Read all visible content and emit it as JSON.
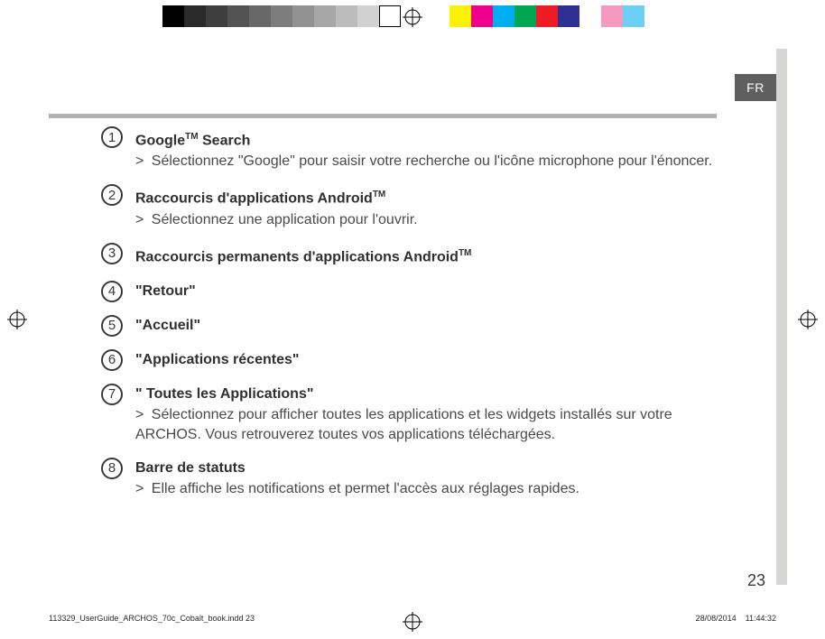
{
  "lang_tab": "FR",
  "page_number": "23",
  "footer": {
    "slug": "113329_UserGuide_ARCHOS_70c_Cobalt_book.indd   23",
    "date": "28/08/2014",
    "time": "11:44:32"
  },
  "colorbar_left": [
    "#000000",
    "#2a2a2a",
    "#3e3e3e",
    "#535353",
    "#686868",
    "#7d7d7d",
    "#929292",
    "#a7a7a7",
    "#bcbcbc",
    "#d1d1d1",
    "#ffffff"
  ],
  "colorbar_right": [
    "#fff200",
    "#ec008c",
    "#00aeef",
    "#00a651",
    "#ed1c24",
    "#2e3192",
    "#ffffff",
    "#f49ac1",
    "#6dcff6",
    "#ffffff"
  ],
  "items": [
    {
      "num": "1",
      "title_pre": "Google",
      "title_tm": "TM",
      "title_post": " Search",
      "desc": "Sélectionnez \"Google\" pour saisir votre recherche ou l'icône microphone pour l'énoncer."
    },
    {
      "num": "2",
      "title_pre": "Raccourcis d'applications Android",
      "title_tm": "TM",
      "title_post": "",
      "desc": "Sélectionnez une application pour l'ouvrir."
    },
    {
      "num": "3",
      "title_pre": "Raccourcis permanents d'applications Android",
      "title_tm": "TM",
      "title_post": "",
      "desc": ""
    },
    {
      "num": "4",
      "title_pre": "\"Retour\"",
      "title_tm": "",
      "title_post": "",
      "desc": ""
    },
    {
      "num": "5",
      "title_pre": "\"Accueil\"",
      "title_tm": "",
      "title_post": "",
      "desc": ""
    },
    {
      "num": "6",
      "title_pre": "\"Applications récentes\"",
      "title_tm": "",
      "title_post": "",
      "desc": ""
    },
    {
      "num": "7",
      "title_pre": "\" Toutes les Applications\"",
      "title_tm": "",
      "title_post": "",
      "desc": "Sélectionnez pour afficher toutes les applications et les widgets installés sur votre ARCHOS. Vous retrouverez toutes vos applications téléchargées."
    },
    {
      "num": "8",
      "title_pre": "Barre de statuts",
      "title_tm": "",
      "title_post": "",
      "desc": "Elle affiche les notifications et permet l'accès aux réglages rapides."
    }
  ]
}
